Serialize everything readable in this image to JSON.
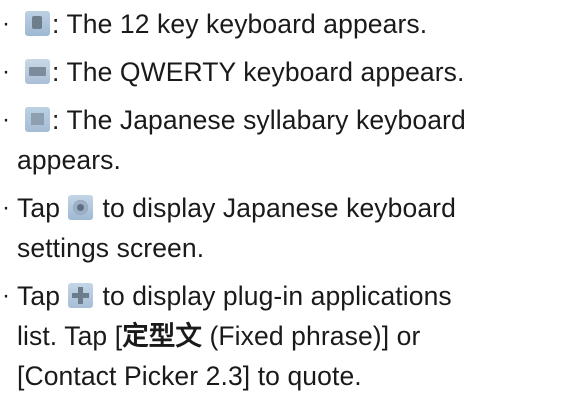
{
  "bullet_char": "·",
  "items": [
    {
      "icon": "12-key-keyboard-icon",
      "text": ": The 12 key keyboard appears."
    },
    {
      "icon": "qwerty-keyboard-icon",
      "text": ": The QWERTY keyboard appears."
    },
    {
      "icon": "japanese-syllabary-keyboard-icon",
      "text": ": The Japanese syllabary keyboard",
      "text_line2": "appears."
    },
    {
      "prefix": "Tap",
      "icon": "settings-icon",
      "text": "to display Japanese keyboard",
      "text_line2": "settings screen."
    },
    {
      "prefix": "Tap",
      "icon": "plug-in-icon",
      "text": "to display plug-in applications",
      "text_line2_pre": "list. Tap [",
      "text_line2_bold": "定型文",
      "text_line2_post": " (Fixed phrase)] or",
      "text_line3": "[Contact Picker 2.3] to quote."
    }
  ]
}
